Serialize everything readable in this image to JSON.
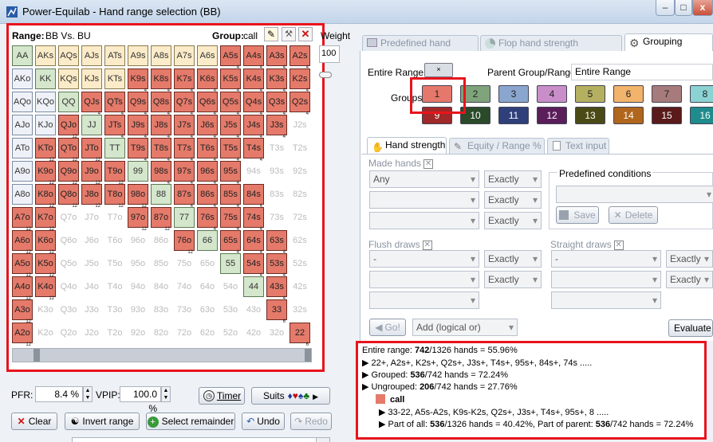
{
  "window": {
    "title": "Power-Equilab - Hand range selection (BB)",
    "min": "–",
    "max": "□",
    "close": "x"
  },
  "range": {
    "label": "Range:",
    "value": "BB Vs. BU",
    "group_label": "Group:",
    "group_value": "call",
    "weight_label": "Weight",
    "weight_value": "100"
  },
  "grid": {
    "rows": [
      [
        "AA",
        "AKs",
        "AQs",
        "AJs",
        "ATs",
        "A9s",
        "A8s",
        "A7s",
        "A6s",
        "A5s",
        "A4s",
        "A3s",
        "A2s"
      ],
      [
        "AKo",
        "KK",
        "KQs",
        "KJs",
        "KTs",
        "K9s",
        "K8s",
        "K7s",
        "K6s",
        "K5s",
        "K4s",
        "K3s",
        "K2s"
      ],
      [
        "AQo",
        "KQo",
        "QQ",
        "QJs",
        "QTs",
        "Q9s",
        "Q8s",
        "Q7s",
        "Q6s",
        "Q5s",
        "Q4s",
        "Q3s",
        "Q2s"
      ],
      [
        "AJo",
        "KJo",
        "QJo",
        "JJ",
        "JTs",
        "J9s",
        "J8s",
        "J7s",
        "J6s",
        "J5s",
        "J4s",
        "J3s",
        "J2s"
      ],
      [
        "ATo",
        "KTo",
        "QTo",
        "JTo",
        "TT",
        "T9s",
        "T8s",
        "T7s",
        "T6s",
        "T5s",
        "T4s",
        "T3s",
        "T2s"
      ],
      [
        "A9o",
        "K9o",
        "Q9o",
        "J9o",
        "T9o",
        "99",
        "98s",
        "97s",
        "96s",
        "95s",
        "94s",
        "93s",
        "92s"
      ],
      [
        "A8o",
        "K8o",
        "Q8o",
        "J8o",
        "T8o",
        "98o",
        "88",
        "87s",
        "86s",
        "85s",
        "84s",
        "83s",
        "82s"
      ],
      [
        "A7o",
        "K7o",
        "Q7o",
        "J7o",
        "T7o",
        "97o",
        "87o",
        "77",
        "76s",
        "75s",
        "74s",
        "73s",
        "72s"
      ],
      [
        "A6o",
        "K6o",
        "Q6o",
        "J6o",
        "T6o",
        "96o",
        "86o",
        "76o",
        "66",
        "65s",
        "64s",
        "63s",
        "62s"
      ],
      [
        "A5o",
        "K5o",
        "Q5o",
        "J5o",
        "T5o",
        "95o",
        "85o",
        "75o",
        "65o",
        "55",
        "54s",
        "53s",
        "52s"
      ],
      [
        "A4o",
        "K4o",
        "Q4o",
        "J4o",
        "T4o",
        "94o",
        "84o",
        "74o",
        "64o",
        "54o",
        "44",
        "43s",
        "42s"
      ],
      [
        "A3o",
        "K3o",
        "Q3o",
        "J3o",
        "T3o",
        "93o",
        "83o",
        "73o",
        "63o",
        "53o",
        "43o",
        "33",
        "32s"
      ],
      [
        "A2o",
        "K2o",
        "Q2o",
        "J2o",
        "T2o",
        "92o",
        "82o",
        "72o",
        "62o",
        "52o",
        "42o",
        "32o",
        "22"
      ]
    ],
    "state": [
      "PSSSSSSSSRRRR",
      "OPSSSRRRRRRRR",
      "OOPRRRRRRRRRR",
      "OORPRRRRRRRRE",
      "ORRRPRRRRRREE",
      "ORRRRPRRRREEE",
      "ORRRRRPRRRREE",
      "RREEERRPRRREE",
      "RREEEEERPRRRE",
      "RREEEEEEEPRRE",
      "RREEEEEEEEPRE",
      "REEEEEEEEEERE",
      "REEEEEEEEEEER"
    ],
    "sub_suited": "4",
    "sub_offsuit": "12",
    "sub_pair": "6"
  },
  "stats": {
    "pfr_label": "PFR:",
    "pfr_value": "8.4 %",
    "vpip_label": "VPIP:",
    "vpip_value": "100.0 %"
  },
  "buttons": {
    "timer": "Timer",
    "suits": "Suits",
    "clear": "Clear",
    "invert": "Invert range",
    "select_remainder": "Select remainder",
    "undo": "Undo",
    "redo": "Redo"
  },
  "tabs": {
    "predefined": "Predefined hand ranges",
    "flop": "Flop hand strength distribution",
    "grouping": "Grouping options"
  },
  "grouping": {
    "entire_range_label": "Entire Range:",
    "entire_range_btn": "×",
    "parent_label": "Parent Group/Range:",
    "parent_value": "Entire Range",
    "groups_label": "Groups:",
    "row1": [
      {
        "n": "1",
        "c": "#e5786a"
      },
      {
        "n": "2",
        "c": "#7fa37a"
      },
      {
        "n": "3",
        "c": "#8aa6cf"
      },
      {
        "n": "4",
        "c": "#c98ec9"
      },
      {
        "n": "5",
        "c": "#b5b060"
      },
      {
        "n": "6",
        "c": "#f2b36b"
      },
      {
        "n": "7",
        "c": "#a77b7b"
      },
      {
        "n": "8",
        "c": "#8bd3d3"
      }
    ],
    "row2": [
      {
        "n": "9",
        "c": "#a02828"
      },
      {
        "n": "10",
        "c": "#2a4a2a"
      },
      {
        "n": "11",
        "c": "#2e3f7a"
      },
      {
        "n": "12",
        "c": "#5a1e5a"
      },
      {
        "n": "13",
        "c": "#4a4a16"
      },
      {
        "n": "14",
        "c": "#b0661c"
      },
      {
        "n": "15",
        "c": "#5a1a1a"
      },
      {
        "n": "16",
        "c": "#1e8c8c"
      }
    ]
  },
  "subtabs": {
    "hand_strength": "Hand strength",
    "equity": "Equity / Range %",
    "text_input": "Text input"
  },
  "conditions": {
    "made_hands": "Made hands",
    "any": "Any",
    "exactly": "Exactly",
    "predefined_conditions": "Predefined conditions",
    "save": "Save",
    "delete": "Delete",
    "flush_draws": "Flush draws",
    "straight_draws": "Straight draws",
    "dash": "-",
    "go": "Go!",
    "add": "Add (logical or)",
    "evaluate": "Evaluate"
  },
  "summary": {
    "l1_pre": "Entire range: ",
    "l1_b": "742",
    "l1_post": "/1326 hands = 55.96%",
    "l2": "22+, A2s+, K2s+, Q2s+, J3s+, T4s+, 95s+, 84s+, 74s .....",
    "l3_pre": "Grouped: ",
    "l3_b": "536",
    "l3_post": "/742 hands = 72.24%",
    "l4_pre": "Ungrouped: ",
    "l4_b": "206",
    "l4_post": "/742 hands = 27.76%",
    "group_name": "call",
    "l6": "33-22, A5s-A2s, K9s-K2s, Q2s+, J3s+, T4s+, 95s+, 8 .....",
    "l7_pre": "Part of all: ",
    "l7_b": "536",
    "l7_mid": "/1326 hands = 40.42%, Part of parent: ",
    "l7_b2": "536",
    "l7_post": "/742 hands = 72.24%"
  },
  "colors": {
    "selected": "#e57a6a",
    "highlight": "#e8141c"
  }
}
